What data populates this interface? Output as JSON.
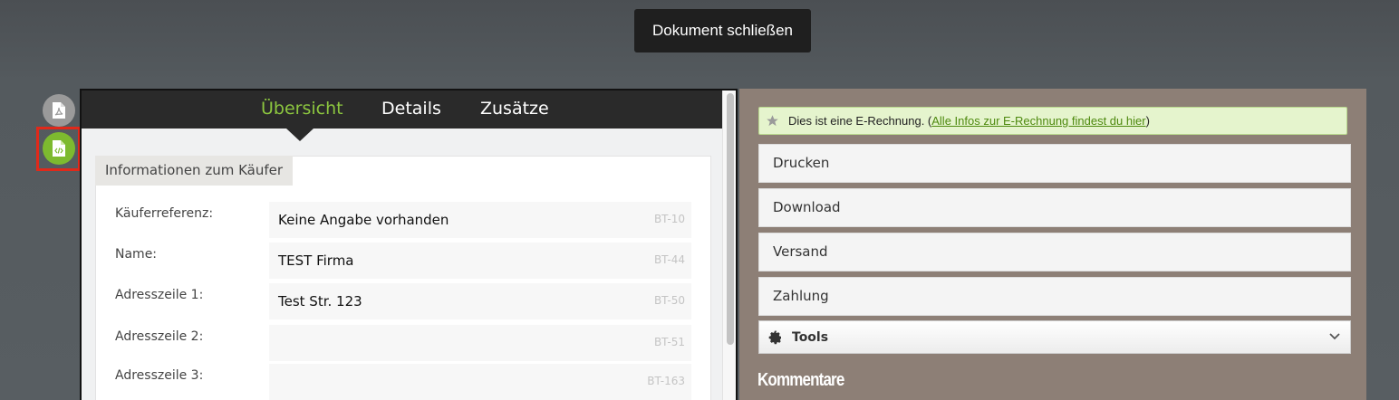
{
  "header": {
    "close_document": "Dokument schließen"
  },
  "side_icons": [
    {
      "name": "pdf-document-icon",
      "state": "inactive"
    },
    {
      "name": "xml-document-icon",
      "state": "active",
      "highlighted": true
    }
  ],
  "tabs": [
    {
      "label": "Übersicht",
      "active": true
    },
    {
      "label": "Details",
      "active": false
    },
    {
      "label": "Zusätze",
      "active": false
    }
  ],
  "section": {
    "title": "Informationen zum Käufer"
  },
  "fields": [
    {
      "label": "Käuferreferenz:",
      "value": "Keine Angabe vorhanden",
      "code": "BT-10"
    },
    {
      "label": "Name:",
      "value": "TEST Firma",
      "code": "BT-44"
    },
    {
      "label": "Adresszeile 1:",
      "value": "Test Str. 123",
      "code": "BT-50"
    },
    {
      "label": "Adresszeile 2:",
      "value": "",
      "code": "BT-51"
    },
    {
      "label": "Adresszeile 3:",
      "value": "",
      "code": "BT-163"
    }
  ],
  "info": {
    "text_before": "Dies ist eine E-Rechnung. (",
    "link": "Alle Infos zur E-Rechnung findest du hier",
    "text_after": ")"
  },
  "actions": [
    "Drucken",
    "Download",
    "Versand",
    "Zahlung"
  ],
  "tools": {
    "label": "Tools"
  },
  "comments": {
    "heading": "Kommentare"
  },
  "colors": {
    "accent_green": "#8cc63f",
    "highlight_red": "#e0291a",
    "right_panel_bg": "#8d7f76",
    "tabbar_bg": "#2a2a2a"
  }
}
